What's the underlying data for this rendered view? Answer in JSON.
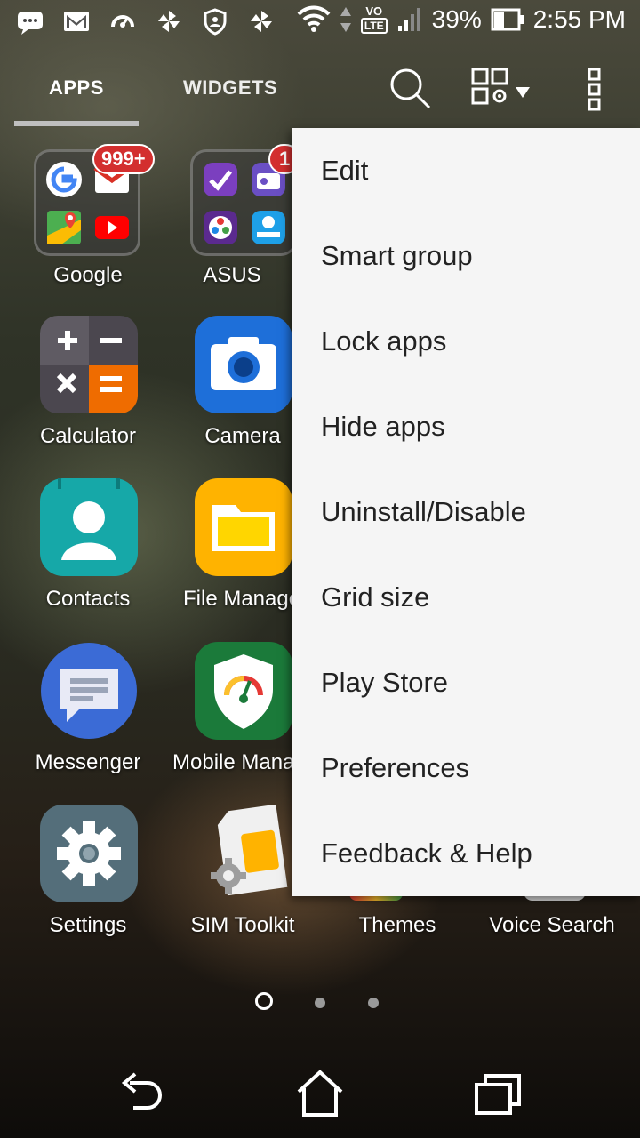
{
  "status_bar": {
    "battery": "39%",
    "time": "2:55 PM",
    "network_top": "VO",
    "network_bottom": "LTE"
  },
  "tabs": {
    "apps": "APPS",
    "widgets": "WIDGETS"
  },
  "apps": [
    {
      "label": "Google"
    },
    {
      "label": "ASUS"
    },
    {
      "label": "Calculator"
    },
    {
      "label": "Camera"
    },
    {
      "label": "Contacts"
    },
    {
      "label": "File Manage"
    },
    {
      "label": "Messenger"
    },
    {
      "label": "Mobile Mana"
    },
    {
      "label": "Settings"
    },
    {
      "label": "SIM Toolkit"
    },
    {
      "label": "Themes"
    },
    {
      "label": "Voice Search"
    }
  ],
  "badges": {
    "google": "999+",
    "asus": "1"
  },
  "menu": {
    "items": [
      {
        "label": "Edit"
      },
      {
        "label": "Smart group"
      },
      {
        "label": "Lock apps"
      },
      {
        "label": "Hide apps"
      },
      {
        "label": "Uninstall/Disable"
      },
      {
        "label": "Grid size"
      },
      {
        "label": "Play Store"
      },
      {
        "label": "Preferences"
      },
      {
        "label": "Feedback & Help"
      }
    ]
  },
  "colors": {
    "menu_bg": "#f5f5f5",
    "badge": "#d32f2f",
    "tab_indicator": "#bfbfbf"
  }
}
